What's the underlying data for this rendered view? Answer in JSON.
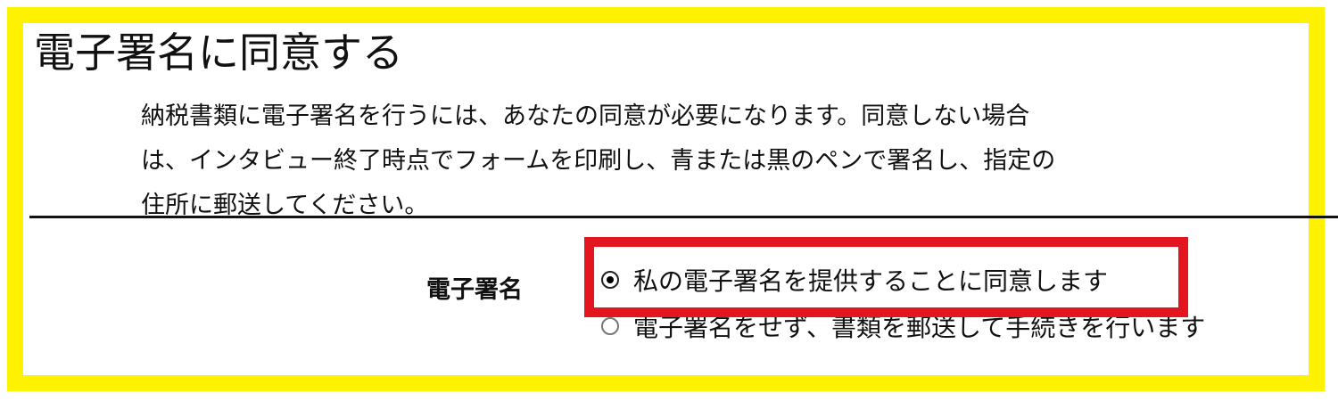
{
  "title": "電子署名に同意する",
  "description": {
    "lines": [
      "納税書類に電子署名を行うには、あなたの同意が必要になります。同意しない場合",
      "は、インタビュー終了時点でフォームを印刷し、青または黒のペンで署名し、指定の",
      "住所に郵送してください。"
    ]
  },
  "signature_field": {
    "label": "電子署名",
    "options": [
      {
        "label": "私の電子署名を提供することに同意します",
        "selected": true
      },
      {
        "label": "電子署名をせず、書類を郵送して手続きを行います",
        "selected": false
      }
    ]
  },
  "colors": {
    "frame": "#fff200",
    "highlight": "#e3151f"
  }
}
